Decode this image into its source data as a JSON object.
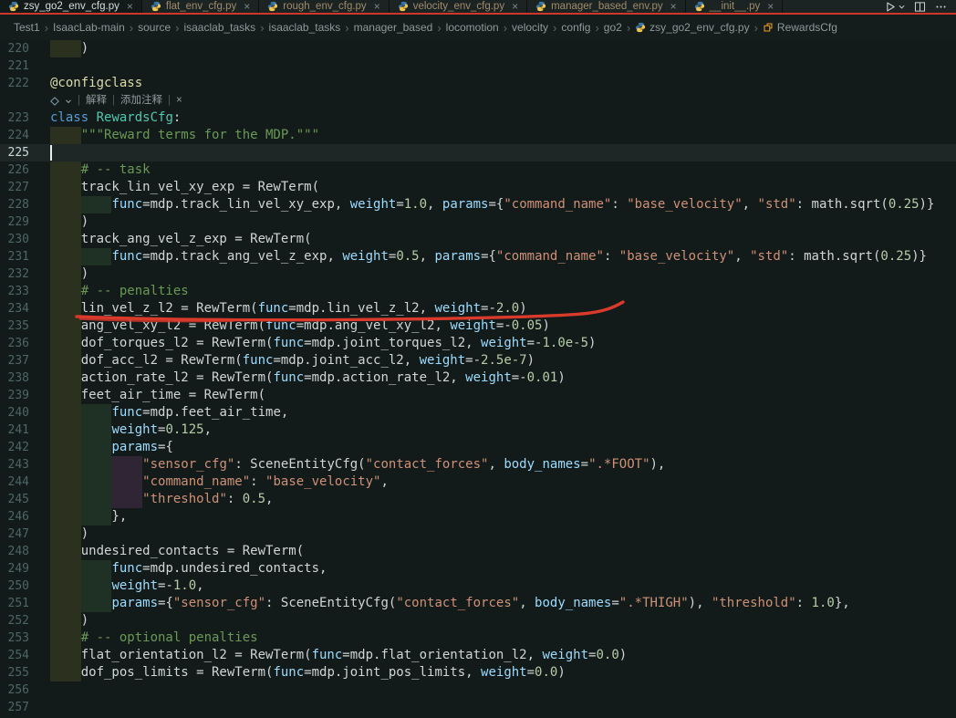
{
  "tab_bar": {
    "close_glyph": "×",
    "tabs": [
      {
        "label": "zsy_go2_env_cfg.py",
        "active": true
      },
      {
        "label": "flat_env_cfg.py",
        "active": false
      },
      {
        "label": "rough_env_cfg.py",
        "active": false
      },
      {
        "label": "velocity_env_cfg.py",
        "active": false
      },
      {
        "label": "manager_based_env.py",
        "active": false
      },
      {
        "label": "__init__.py",
        "active": false
      }
    ]
  },
  "breadcrumb": {
    "separator": "›",
    "folders": [
      "Test1",
      "IsaacLab-main",
      "source",
      "isaaclab_tasks",
      "isaaclab_tasks",
      "manager_based",
      "locomotion",
      "velocity",
      "config",
      "go2"
    ],
    "file": "zsy_go2_env_cfg.py",
    "symbol": "RewardsCfg"
  },
  "codelens": {
    "separator": "|",
    "explain_label": "解释",
    "add_comment_label": "添加注释",
    "close_glyph": "×"
  },
  "annotation": {
    "type": "red-underline",
    "target_line": 234,
    "color": "#d93a2b"
  },
  "editor": {
    "current_line": 225,
    "lines": [
      {
        "no": 220,
        "t": [
          [
            "w",
            "    )"
          ]
        ]
      },
      {
        "no": 221,
        "t": []
      },
      {
        "no": 222,
        "t": [
          [
            "deco",
            "@configclass"
          ]
        ]
      },
      {
        "lens": true
      },
      {
        "no": 223,
        "t": [
          [
            "kw",
            "class"
          ],
          [
            "w",
            " "
          ],
          [
            "typ",
            "RewardsCfg"
          ],
          [
            "w",
            ":"
          ]
        ]
      },
      {
        "no": 224,
        "t": [
          [
            "c",
            "    \"\"\"Reward terms for the MDP.\"\"\""
          ]
        ]
      },
      {
        "no": 225,
        "t": []
      },
      {
        "no": 226,
        "t": [
          [
            "c",
            "    # -- task"
          ]
        ]
      },
      {
        "no": 227,
        "t": [
          [
            "w",
            "    track_lin_vel_xy_exp = RewTerm("
          ]
        ]
      },
      {
        "no": 228,
        "t": [
          [
            "w",
            "        "
          ],
          [
            "p",
            "func"
          ],
          [
            "w",
            "=mdp.track_lin_vel_xy_exp, "
          ],
          [
            "p",
            "weight"
          ],
          [
            "w",
            "="
          ],
          [
            "n",
            "1.0"
          ],
          [
            "w",
            ", "
          ],
          [
            "p",
            "params"
          ],
          [
            "w",
            "={"
          ],
          [
            "s",
            "\"command_name\""
          ],
          [
            "w",
            ": "
          ],
          [
            "s",
            "\"base_velocity\""
          ],
          [
            "w",
            ", "
          ],
          [
            "s",
            "\"std\""
          ],
          [
            "w",
            ": math.sqrt("
          ],
          [
            "n",
            "0.25"
          ],
          [
            "w",
            ")}"
          ]
        ]
      },
      {
        "no": 229,
        "t": [
          [
            "w",
            "    )"
          ]
        ]
      },
      {
        "no": 230,
        "t": [
          [
            "w",
            "    track_ang_vel_z_exp = RewTerm("
          ]
        ]
      },
      {
        "no": 231,
        "t": [
          [
            "w",
            "        "
          ],
          [
            "p",
            "func"
          ],
          [
            "w",
            "=mdp.track_ang_vel_z_exp, "
          ],
          [
            "p",
            "weight"
          ],
          [
            "w",
            "="
          ],
          [
            "n",
            "0.5"
          ],
          [
            "w",
            ", "
          ],
          [
            "p",
            "params"
          ],
          [
            "w",
            "={"
          ],
          [
            "s",
            "\"command_name\""
          ],
          [
            "w",
            ": "
          ],
          [
            "s",
            "\"base_velocity\""
          ],
          [
            "w",
            ", "
          ],
          [
            "s",
            "\"std\""
          ],
          [
            "w",
            ": math.sqrt("
          ],
          [
            "n",
            "0.25"
          ],
          [
            "w",
            ")}"
          ]
        ]
      },
      {
        "no": 232,
        "t": [
          [
            "w",
            "    )"
          ]
        ]
      },
      {
        "no": 233,
        "t": [
          [
            "c",
            "    # -- penalties"
          ]
        ]
      },
      {
        "no": 234,
        "t": [
          [
            "w",
            "    lin_vel_z_l2 = RewTerm("
          ],
          [
            "p",
            "func"
          ],
          [
            "w",
            "=mdp.lin_vel_z_l2, "
          ],
          [
            "p",
            "weight"
          ],
          [
            "w",
            "=-"
          ],
          [
            "n",
            "2.0"
          ],
          [
            "w",
            ")"
          ]
        ]
      },
      {
        "no": 235,
        "t": [
          [
            "w",
            "    ang_vel_xy_l2 = RewTerm("
          ],
          [
            "p",
            "func"
          ],
          [
            "w",
            "=mdp.ang_vel_xy_l2, "
          ],
          [
            "p",
            "weight"
          ],
          [
            "w",
            "=-"
          ],
          [
            "n",
            "0.05"
          ],
          [
            "w",
            ")"
          ]
        ]
      },
      {
        "no": 236,
        "t": [
          [
            "w",
            "    dof_torques_l2 = RewTerm("
          ],
          [
            "p",
            "func"
          ],
          [
            "w",
            "=mdp.joint_torques_l2, "
          ],
          [
            "p",
            "weight"
          ],
          [
            "w",
            "=-"
          ],
          [
            "n",
            "1.0e-5"
          ],
          [
            "w",
            ")"
          ]
        ]
      },
      {
        "no": 237,
        "t": [
          [
            "w",
            "    dof_acc_l2 = RewTerm("
          ],
          [
            "p",
            "func"
          ],
          [
            "w",
            "=mdp.joint_acc_l2, "
          ],
          [
            "p",
            "weight"
          ],
          [
            "w",
            "=-"
          ],
          [
            "n",
            "2.5e-7"
          ],
          [
            "w",
            ")"
          ]
        ]
      },
      {
        "no": 238,
        "t": [
          [
            "w",
            "    action_rate_l2 = RewTerm("
          ],
          [
            "p",
            "func"
          ],
          [
            "w",
            "=mdp.action_rate_l2, "
          ],
          [
            "p",
            "weight"
          ],
          [
            "w",
            "=-"
          ],
          [
            "n",
            "0.01"
          ],
          [
            "w",
            ")"
          ]
        ]
      },
      {
        "no": 239,
        "t": [
          [
            "w",
            "    feet_air_time = RewTerm("
          ]
        ]
      },
      {
        "no": 240,
        "t": [
          [
            "w",
            "        "
          ],
          [
            "p",
            "func"
          ],
          [
            "w",
            "=mdp.feet_air_time,"
          ]
        ]
      },
      {
        "no": 241,
        "t": [
          [
            "w",
            "        "
          ],
          [
            "p",
            "weight"
          ],
          [
            "w",
            "="
          ],
          [
            "n",
            "0.125"
          ],
          [
            "w",
            ","
          ]
        ]
      },
      {
        "no": 242,
        "t": [
          [
            "w",
            "        "
          ],
          [
            "p",
            "params"
          ],
          [
            "w",
            "={"
          ]
        ]
      },
      {
        "no": 243,
        "t": [
          [
            "w",
            "            "
          ],
          [
            "s",
            "\"sensor_cfg\""
          ],
          [
            "w",
            ": SceneEntityCfg("
          ],
          [
            "s",
            "\"contact_forces\""
          ],
          [
            "w",
            ", "
          ],
          [
            "p",
            "body_names"
          ],
          [
            "w",
            "="
          ],
          [
            "s",
            "\".*FOOT\""
          ],
          [
            "w",
            "),"
          ]
        ]
      },
      {
        "no": 244,
        "t": [
          [
            "w",
            "            "
          ],
          [
            "s",
            "\"command_name\""
          ],
          [
            "w",
            ": "
          ],
          [
            "s",
            "\"base_velocity\""
          ],
          [
            "w",
            ","
          ]
        ]
      },
      {
        "no": 245,
        "t": [
          [
            "w",
            "            "
          ],
          [
            "s",
            "\"threshold\""
          ],
          [
            "w",
            ": "
          ],
          [
            "n",
            "0.5"
          ],
          [
            "w",
            ","
          ]
        ]
      },
      {
        "no": 246,
        "t": [
          [
            "w",
            "        },"
          ]
        ]
      },
      {
        "no": 247,
        "t": [
          [
            "w",
            "    )"
          ]
        ]
      },
      {
        "no": 248,
        "t": [
          [
            "w",
            "    undesired_contacts = RewTerm("
          ]
        ]
      },
      {
        "no": 249,
        "t": [
          [
            "w",
            "        "
          ],
          [
            "p",
            "func"
          ],
          [
            "w",
            "=mdp.undesired_contacts,"
          ]
        ]
      },
      {
        "no": 250,
        "t": [
          [
            "w",
            "        "
          ],
          [
            "p",
            "weight"
          ],
          [
            "w",
            "=-"
          ],
          [
            "n",
            "1.0"
          ],
          [
            "w",
            ","
          ]
        ]
      },
      {
        "no": 251,
        "t": [
          [
            "w",
            "        "
          ],
          [
            "p",
            "params"
          ],
          [
            "w",
            "={"
          ],
          [
            "s",
            "\"sensor_cfg\""
          ],
          [
            "w",
            ": SceneEntityCfg("
          ],
          [
            "s",
            "\"contact_forces\""
          ],
          [
            "w",
            ", "
          ],
          [
            "p",
            "body_names"
          ],
          [
            "w",
            "="
          ],
          [
            "s",
            "\".*THIGH\""
          ],
          [
            "w",
            "), "
          ],
          [
            "s",
            "\"threshold\""
          ],
          [
            "w",
            ": "
          ],
          [
            "n",
            "1.0"
          ],
          [
            "w",
            "},"
          ]
        ]
      },
      {
        "no": 252,
        "t": [
          [
            "w",
            "    )"
          ]
        ]
      },
      {
        "no": 253,
        "t": [
          [
            "c",
            "    # -- optional penalties"
          ]
        ]
      },
      {
        "no": 254,
        "t": [
          [
            "w",
            "    flat_orientation_l2 = RewTerm("
          ],
          [
            "p",
            "func"
          ],
          [
            "w",
            "=mdp.flat_orientation_l2, "
          ],
          [
            "p",
            "weight"
          ],
          [
            "w",
            "="
          ],
          [
            "n",
            "0.0"
          ],
          [
            "w",
            ")"
          ]
        ]
      },
      {
        "no": 255,
        "t": [
          [
            "w",
            "    dof_pos_limits = RewTerm("
          ],
          [
            "p",
            "func"
          ],
          [
            "w",
            "=mdp.joint_pos_limits, "
          ],
          [
            "p",
            "weight"
          ],
          [
            "w",
            "="
          ],
          [
            "n",
            "0.0"
          ],
          [
            "w",
            ")"
          ]
        ]
      },
      {
        "no": 256,
        "t": []
      },
      {
        "no": 257,
        "t": []
      }
    ]
  }
}
